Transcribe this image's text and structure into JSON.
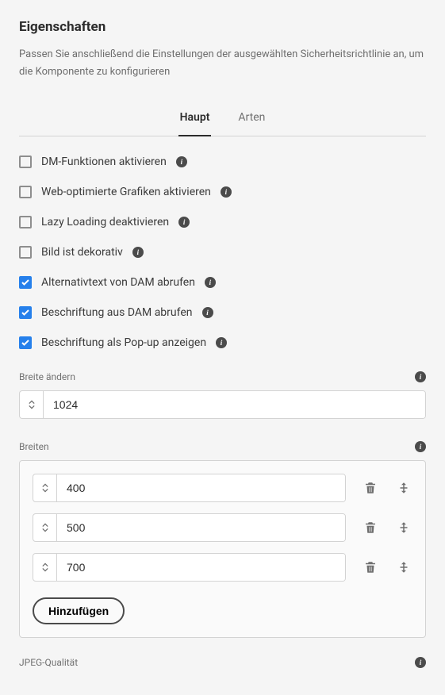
{
  "heading": "Eigenschaften",
  "description": "Passen Sie anschließend die Einstellungen der ausgewählten Sicherheitsrichtlinie an, um die Komponente zu konfigurieren",
  "tabs": {
    "main": "Haupt",
    "types": "Arten"
  },
  "checks": {
    "dm": "DM-Funktionen aktivieren",
    "web": "Web-optimierte Grafiken aktivieren",
    "lazy": "Lazy Loading deaktivieren",
    "decor": "Bild ist dekorativ",
    "alt": "Alternativtext von DAM abrufen",
    "caption": "Beschriftung aus DAM abrufen",
    "popup": "Beschriftung als Pop-up anzeigen"
  },
  "resize": {
    "label": "Breite ändern",
    "value": "1024"
  },
  "widths": {
    "label": "Breiten",
    "items": {
      "w0": "400",
      "w1": "500",
      "w2": "700"
    },
    "add": "Hinzufügen"
  },
  "jpeg": {
    "label": "JPEG-Qualität"
  }
}
